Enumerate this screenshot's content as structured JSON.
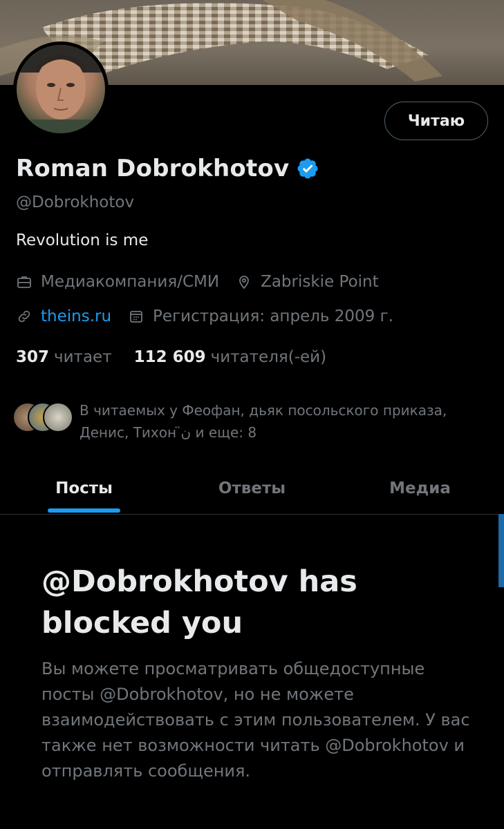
{
  "profile": {
    "name": "Roman Dobrokhotov",
    "handle": "@Dobrokhotov",
    "bio": "Revolution is me",
    "category": "Медиакомпания/СМИ",
    "location": "Zabriskie Point",
    "website": "theins.ru",
    "joined": "Регистрация: апрель 2009 г.",
    "following_count": "307",
    "following_label": "читает",
    "followers_count": "112 609",
    "followers_label": "читателя(-ей)",
    "followed_by_line1": "В читаемых у Феофан, дьяк посольского приказа,",
    "followed_by_line2": "Денис, Тихон ن̈ и еще: 8"
  },
  "actions": {
    "follow_label": "Читаю"
  },
  "tabs": [
    {
      "label": "Посты",
      "active": true
    },
    {
      "label": "Ответы",
      "active": false
    },
    {
      "label": "Медиа",
      "active": false
    }
  ],
  "blocked": {
    "title": "@Dobrokhotov has blocked you",
    "message": "Вы можете просматривать общедоступные посты @Dobrokhotov, но не можете взаимодействовать с этим пользователем. У вас также нет возможности читать @Dobrokhotov и отправлять сообщения."
  },
  "colors": {
    "accent": "#1d9bf0",
    "text": "#e7e9ea",
    "muted": "#71767b",
    "background": "#000000"
  },
  "icons": [
    "verified-badge-icon",
    "briefcase-icon",
    "location-pin-icon",
    "link-icon",
    "calendar-icon"
  ]
}
